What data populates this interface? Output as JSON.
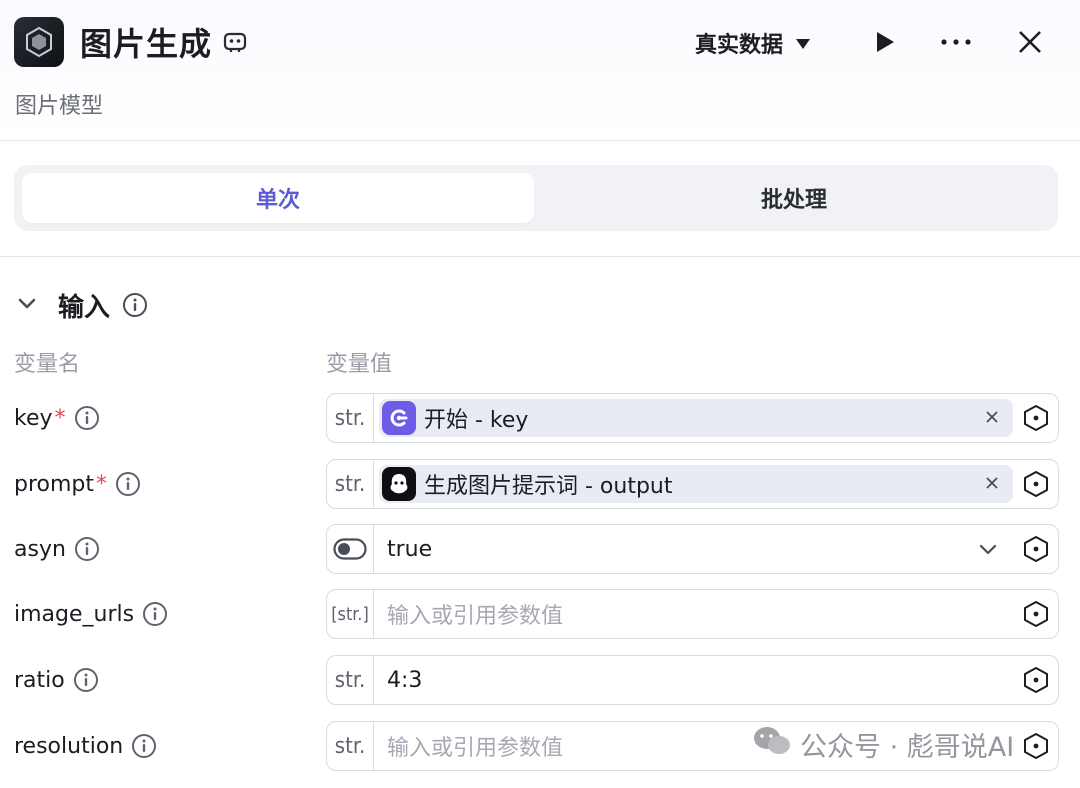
{
  "header": {
    "title": "图片生成",
    "subtitle": "图片模型",
    "data_mode": "真实数据"
  },
  "tabs": [
    {
      "label": "单次",
      "active": true
    },
    {
      "label": "批处理",
      "active": false
    }
  ],
  "input_section": {
    "title": "输入",
    "col_name": "变量名",
    "col_value": "变量值"
  },
  "params": [
    {
      "name": "key",
      "required": true,
      "type": "str.",
      "ref_node": "开始",
      "ref_field": "key",
      "ref_text": "开始 - key"
    },
    {
      "name": "prompt",
      "required": true,
      "type": "str.",
      "ref_node": "生成图片提示词",
      "ref_field": "output",
      "ref_text": "生成图片提示词 - output"
    },
    {
      "name": "asyn",
      "required": false,
      "type": "toggle",
      "value": "true"
    },
    {
      "name": "image_urls",
      "required": false,
      "type": "[str.]",
      "placeholder": "输入或引用参数值"
    },
    {
      "name": "ratio",
      "required": false,
      "type": "str.",
      "value": "4:3"
    },
    {
      "name": "resolution",
      "required": false,
      "type": "str.",
      "placeholder": "输入或引用参数值"
    }
  ],
  "required_mark": "*",
  "watermark": "公众号 · 彪哥说AI",
  "colors": {
    "accent": "#5b5bd6",
    "required": "#e5484d",
    "chip_bg": "#e9ebf4"
  }
}
